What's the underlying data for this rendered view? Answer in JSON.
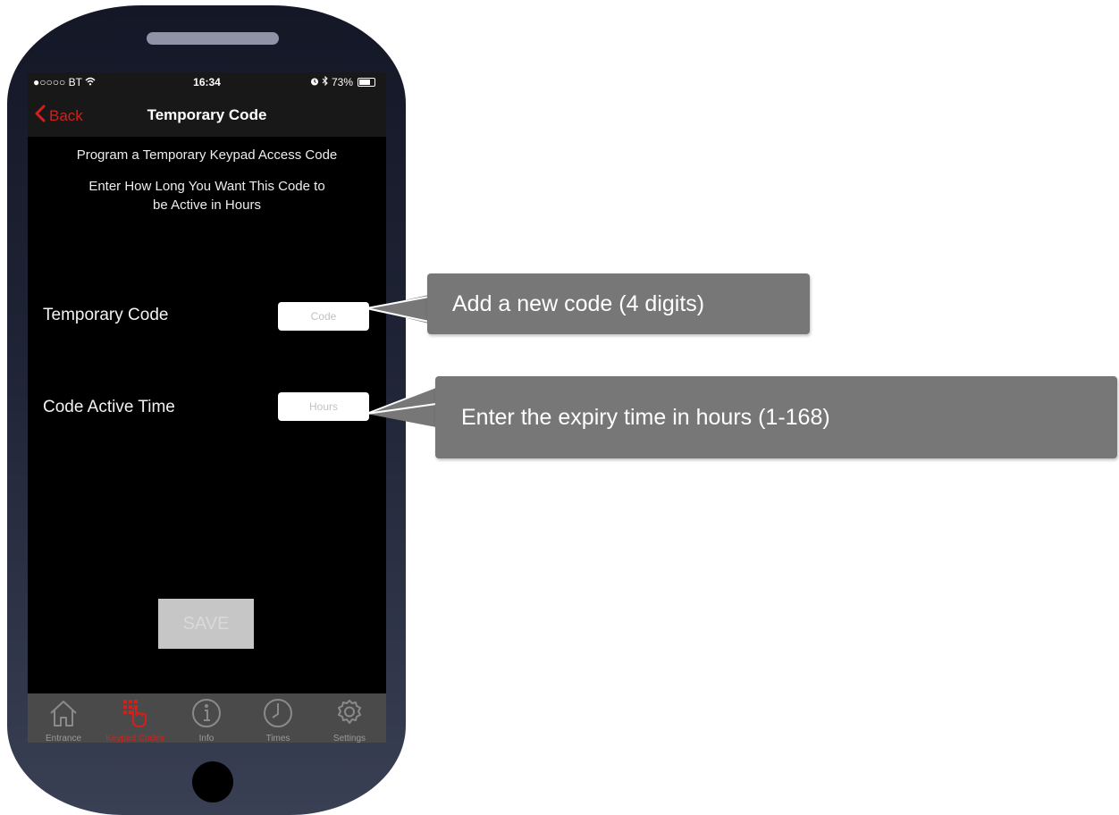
{
  "status_bar": {
    "carrier": "●○○○○ BT",
    "time": "16:34",
    "battery": "73%"
  },
  "nav": {
    "back_label": "Back",
    "title": "Temporary Code"
  },
  "content": {
    "subtitle": "Program a Temporary Keypad Access Code",
    "instruction_line1": "Enter How Long You Want This Code to",
    "instruction_line2": "be Active in Hours",
    "code_label": "Temporary Code",
    "code_placeholder": "Code",
    "time_label": "Code Active Time",
    "time_placeholder": "Hours",
    "save_label": "SAVE"
  },
  "tabs": [
    {
      "label": "Entrance",
      "icon": "house-icon",
      "active": false
    },
    {
      "label": "Keypad Codes",
      "icon": "keypad-hand-icon",
      "active": true
    },
    {
      "label": "Info",
      "icon": "info-icon",
      "active": false
    },
    {
      "label": "Times",
      "icon": "clock-icon",
      "active": false
    },
    {
      "label": "Settings",
      "icon": "gear-icon",
      "active": false
    }
  ],
  "callouts": {
    "code": "Add a new code (4 digits)",
    "time": "Enter the expiry time in hours (1-168)"
  },
  "colors": {
    "accent": "#d0211c",
    "callout_bg": "#777777",
    "tabbar_bg": "#4a4a4a",
    "save_bg": "#c6c6c6"
  }
}
